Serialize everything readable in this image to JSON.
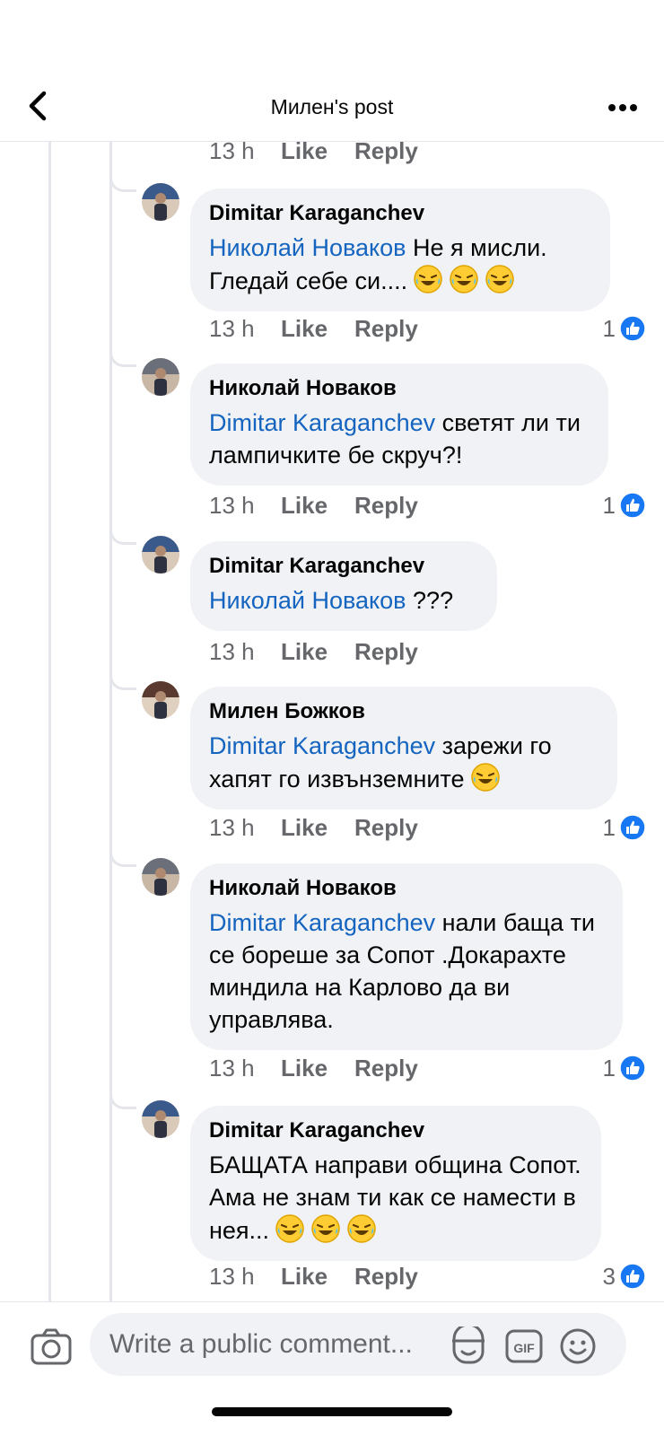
{
  "header": {
    "title": "Милен's post"
  },
  "top_meta": {
    "time": "13 h",
    "like": "Like",
    "reply": "Reply"
  },
  "comments": [
    {
      "author": "Dimitar Karaganchev",
      "mention": "Николай Новаков",
      "text": " Не я мисли. Гледай себе си....",
      "emoji_count": 3,
      "time": "13 h",
      "like": "Like",
      "reply": "Reply",
      "reactions": "1"
    },
    {
      "author": "Николай Новаков",
      "mention": "Dimitar Karaganchev",
      "text": " светят ли ти лампичките бе скруч?!",
      "emoji_count": 0,
      "time": "13 h",
      "like": "Like",
      "reply": "Reply",
      "reactions": "1"
    },
    {
      "author": "Dimitar Karaganchev",
      "mention": "Николай Новаков",
      "text": " ???",
      "emoji_count": 0,
      "time": "13 h",
      "like": "Like",
      "reply": "Reply",
      "reactions": ""
    },
    {
      "author": "Милен Божков",
      "mention": "Dimitar Karaganchev",
      "text": " зарежи го хапят го извънземните",
      "emoji_count": 1,
      "time": "13 h",
      "like": "Like",
      "reply": "Reply",
      "reactions": "1"
    },
    {
      "author": "Николай Новаков",
      "mention": "Dimitar Karaganchev",
      "text": " нали баща ти се бореше за Сопот .Докарахте миндила на Карлово да ви управлява.",
      "emoji_count": 0,
      "time": "13 h",
      "like": "Like",
      "reply": "Reply",
      "reactions": "1"
    },
    {
      "author": "Dimitar Karaganchev",
      "mention": "",
      "text": "БАЩАТА направи община Сопот. Ама не знам ти как се намести в нея...",
      "emoji_count": 3,
      "time": "13 h",
      "like": "Like",
      "reply": "Reply",
      "reactions": "3"
    }
  ],
  "composer": {
    "placeholder": "Write a public comment..."
  },
  "colors": {
    "mention": "#1565c0",
    "like_blue": "#1877f2",
    "bubble": "#f0f2f5",
    "meta": "#65676b"
  },
  "icons": [
    "back-arrow-icon",
    "more-dots-icon",
    "camera-icon",
    "sticker-icon",
    "gif-icon",
    "emoji-icon",
    "like-thumb-icon",
    "laughing-emoji-icon"
  ]
}
